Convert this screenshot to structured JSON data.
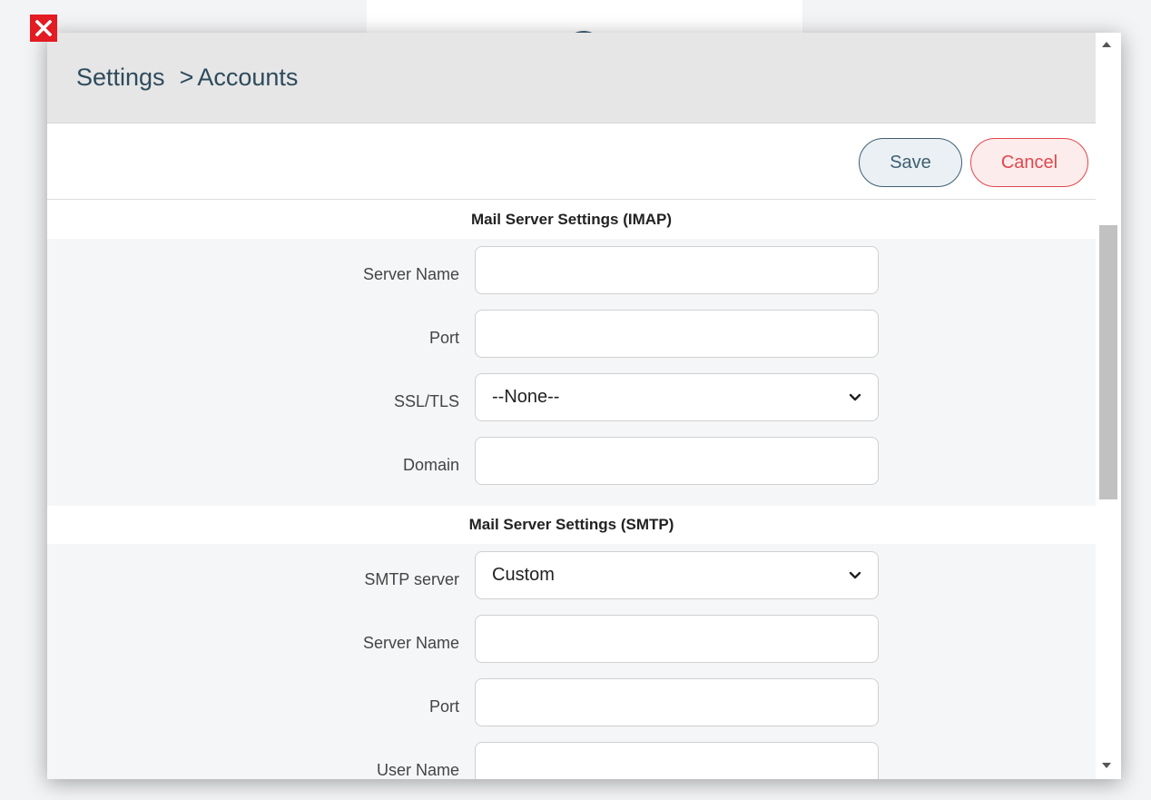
{
  "colors": {
    "brand": "#3e5f72",
    "danger": "#e0474c",
    "close_bg": "#e31b23",
    "header_bg": "#e6e6e6",
    "section_bg": "#f5f6f8"
  },
  "close_button": {
    "icon": "close-icon"
  },
  "header": {
    "breadcrumb_root": "Settings",
    "breadcrumb_sep": ">",
    "breadcrumb_current": "Accounts"
  },
  "toolbar": {
    "save_label": "Save",
    "cancel_label": "Cancel"
  },
  "imap": {
    "title": "Mail Server Settings (IMAP)",
    "server_name_label": "Server Name",
    "server_name_value": "",
    "port_label": "Port",
    "port_value": "",
    "ssl_label": "SSL/TLS",
    "ssl_value": "--None--",
    "domain_label": "Domain",
    "domain_value": ""
  },
  "smtp": {
    "title": "Mail Server Settings (SMTP)",
    "smtp_server_label": "SMTP server",
    "smtp_server_value": "Custom",
    "server_name_label": "Server Name",
    "server_name_value": "",
    "port_label": "Port",
    "port_value": "",
    "user_name_label": "User Name",
    "user_name_value": ""
  }
}
